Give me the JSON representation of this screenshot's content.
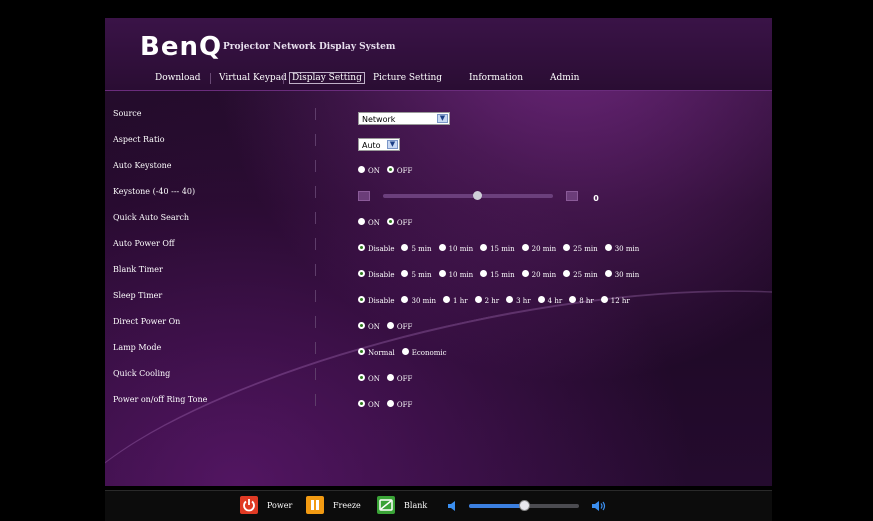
{
  "header": {
    "logo": "BenQ",
    "title": "Projector Network Display System"
  },
  "nav": [
    "Download",
    "Virtual Keypad",
    "Display Setting",
    "Picture Setting",
    "Information",
    "Admin"
  ],
  "active_nav": "Display Setting",
  "settings": {
    "source": {
      "label": "Source",
      "value": "Network"
    },
    "aspect_ratio": {
      "label": "Aspect Ratio",
      "value": "Auto"
    },
    "auto_keystone": {
      "label": "Auto Keystone",
      "options": [
        "ON",
        "OFF"
      ],
      "selected": "OFF"
    },
    "keystone": {
      "label": "Keystone (-40 --- 40)",
      "value": "0"
    },
    "quick_auto_search": {
      "label": "Quick Auto Search",
      "options": [
        "ON",
        "OFF"
      ],
      "selected": "OFF"
    },
    "auto_power_off": {
      "label": "Auto Power Off",
      "options": [
        "Disable",
        "5 min",
        "10 min",
        "15 min",
        "20 min",
        "25 min",
        "30 min"
      ],
      "selected": "Disable"
    },
    "blank_timer": {
      "label": "Blank Timer",
      "options": [
        "Disable",
        "5 min",
        "10 min",
        "15 min",
        "20 min",
        "25 min",
        "30 min"
      ],
      "selected": "Disable"
    },
    "sleep_timer": {
      "label": "Sleep Timer",
      "options": [
        "Disable",
        "30 min",
        "1 hr",
        "2 hr",
        "3 hr",
        "4 hr",
        "8 hr",
        "12 hr"
      ],
      "selected": "Disable"
    },
    "direct_power_on": {
      "label": "Direct Power On",
      "options": [
        "ON",
        "OFF"
      ],
      "selected": "ON"
    },
    "lamp_mode": {
      "label": "Lamp Mode",
      "options": [
        "Normal",
        "Economic"
      ],
      "selected": "Normal"
    },
    "quick_cooling": {
      "label": "Quick Cooling",
      "options": [
        "ON",
        "OFF"
      ],
      "selected": "ON"
    },
    "power_ring_tone": {
      "label": "Power on/off Ring Tone",
      "options": [
        "ON",
        "OFF"
      ],
      "selected": "ON"
    }
  },
  "footer": {
    "power_label": "Power",
    "freeze_label": "Freeze",
    "blank_label": "Blank",
    "volume_level": 0.5,
    "colors": {
      "power": "#e03a24",
      "freeze": "#f29a12",
      "blank": "#3aa337",
      "volume": "#3b7fe0"
    }
  },
  "icons": [
    "power-icon",
    "freeze-icon",
    "blank-icon",
    "volume-low-icon",
    "volume-high-icon",
    "dropdown-arrow-icon",
    "keystone-down-icon",
    "keystone-up-icon"
  ]
}
